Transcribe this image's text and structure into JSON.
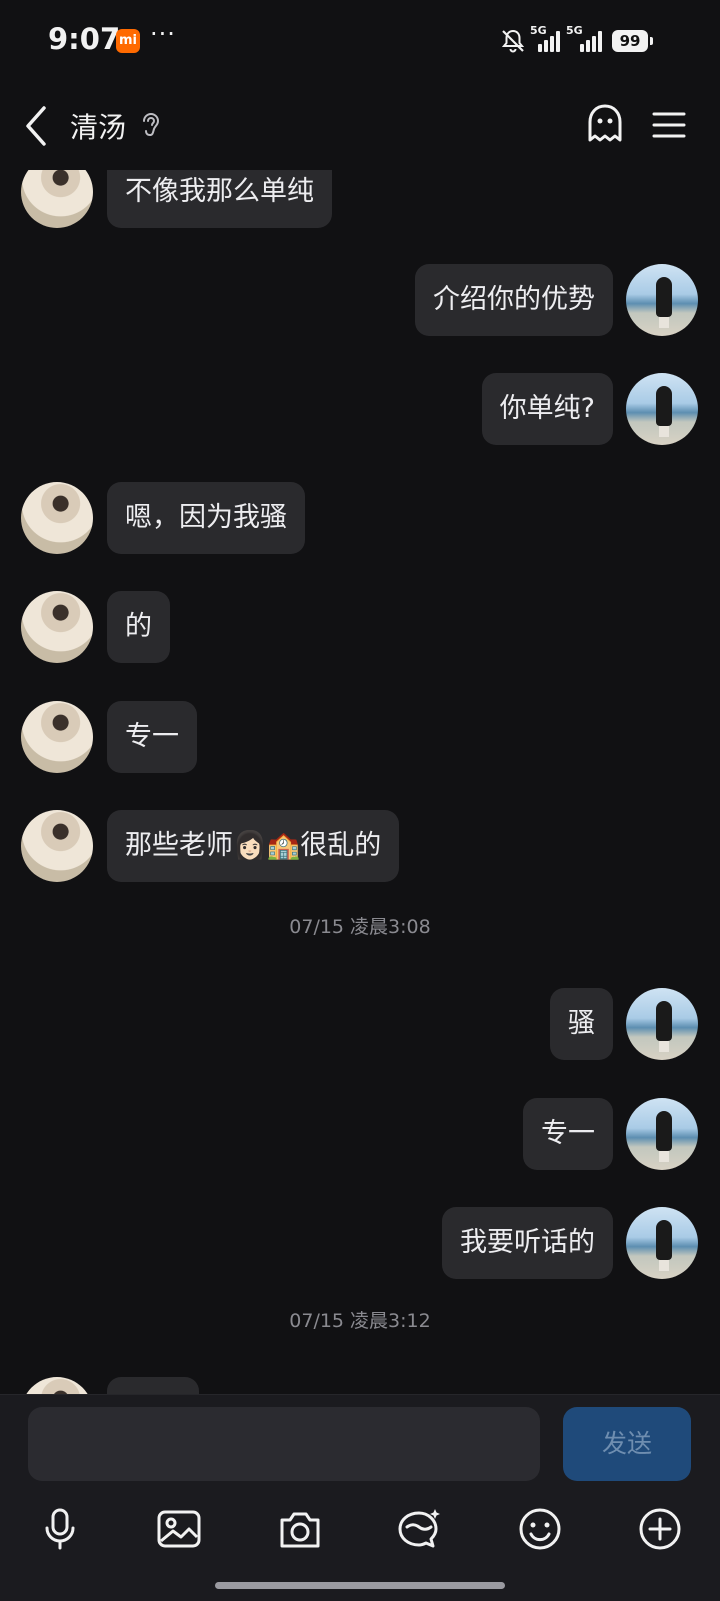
{
  "status_bar": {
    "time": "9:07",
    "badge": "mi",
    "more": "···",
    "network_1": "5G",
    "network_2": "5G",
    "battery": "99"
  },
  "header": {
    "contact_name": "清汤"
  },
  "messages": [
    {
      "side": "left",
      "text": "不像我那么单纯"
    },
    {
      "side": "right",
      "text": "介绍你的优势"
    },
    {
      "side": "right",
      "text": "你单纯?"
    },
    {
      "side": "left",
      "text": "嗯，因为我骚"
    },
    {
      "side": "left",
      "text": "的"
    },
    {
      "side": "left",
      "text": "专一"
    },
    {
      "side": "left",
      "text": "那些老师👩🏻🏫很乱的"
    },
    {
      "side": "right",
      "text": "骚"
    },
    {
      "side": "right",
      "text": "专一"
    },
    {
      "side": "right",
      "text": "我要听话的"
    },
    {
      "side": "left",
      "text": ""
    }
  ],
  "timestamps": [
    "07/15 凌晨3:08",
    "07/15 凌晨3:12"
  ],
  "input": {
    "value": "",
    "send_label": "发送"
  },
  "toolbar": [
    "microphone-icon",
    "image-icon",
    "camera-icon",
    "sticker-icon",
    "emoji-icon",
    "plus-icon"
  ],
  "colors": {
    "background": "#111113",
    "bubble": "#2a2a2d",
    "send_button": "#1f4a7a",
    "timestamp": "#8a8a90"
  }
}
